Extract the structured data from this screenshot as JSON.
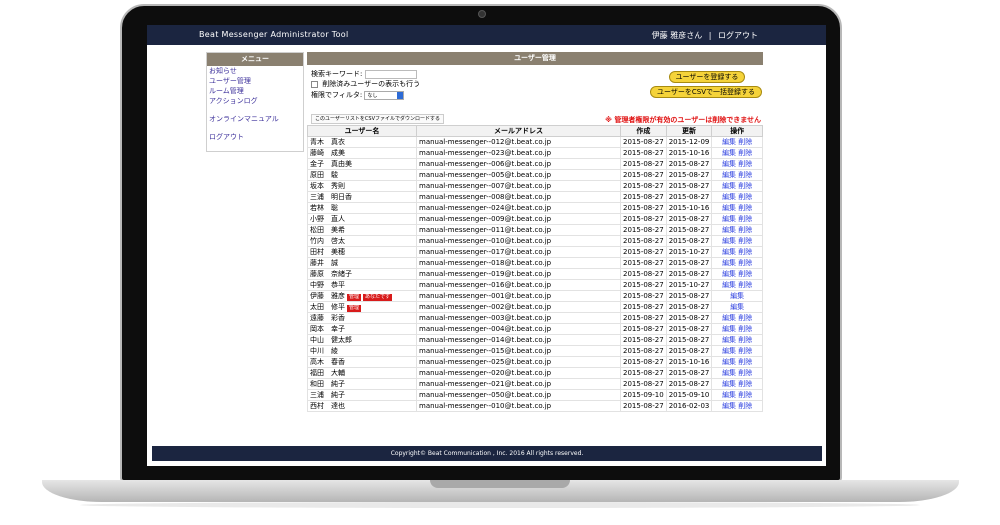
{
  "app": {
    "title": "Beat Messenger Administrator Tool",
    "user_name": "伊藤 雅彦さん",
    "separator": "|",
    "logout": "ログアウト"
  },
  "menu": {
    "header": "メニュー",
    "items_top": [
      "お知らせ",
      "ユーザー管理",
      "ルーム管理",
      "アクションログ"
    ],
    "manual": "オンラインマニュアル",
    "logout": "ログアウト"
  },
  "main": {
    "header": "ユーザー管理",
    "keyword_label": "検索キーワード:",
    "show_deleted_label": "削除済みユーザーの表示も行う",
    "filter_label": "権限でフィルタ:",
    "filter_value": "なし",
    "register_button": "ユーザーを登録する",
    "csv_register_button": "ユーザーをCSVで一括登録する",
    "csv_download": "このユーザーリストをCSVファイルでダウンロードする",
    "warning": "※ 管理者権限が有効のユーザーは削除できません"
  },
  "table": {
    "headers": [
      "ユーザー名",
      "メールアドレス",
      "作成",
      "更新",
      "操作"
    ],
    "edit": "編集",
    "delete": "削除",
    "rows": [
      {
        "name": "青木　真衣",
        "email": "manual-messenger--012@t.beat.co.jp",
        "created": "2015-08-27",
        "updated": "2015-12-09",
        "badges": [],
        "deletable": true
      },
      {
        "name": "藤崎　成美",
        "email": "manual-messenger--023@t.beat.co.jp",
        "created": "2015-08-27",
        "updated": "2015-10-16",
        "badges": [],
        "deletable": true
      },
      {
        "name": "金子　真由美",
        "email": "manual-messenger--006@t.beat.co.jp",
        "created": "2015-08-27",
        "updated": "2015-08-27",
        "badges": [],
        "deletable": true
      },
      {
        "name": "原田　駿",
        "email": "manual-messenger--005@t.beat.co.jp",
        "created": "2015-08-27",
        "updated": "2015-08-27",
        "badges": [],
        "deletable": true
      },
      {
        "name": "坂本　秀則",
        "email": "manual-messenger--007@t.beat.co.jp",
        "created": "2015-08-27",
        "updated": "2015-08-27",
        "badges": [],
        "deletable": true
      },
      {
        "name": "三浦　明日香",
        "email": "manual-messenger--008@t.beat.co.jp",
        "created": "2015-08-27",
        "updated": "2015-08-27",
        "badges": [],
        "deletable": true
      },
      {
        "name": "若林　聡",
        "email": "manual-messenger--024@t.beat.co.jp",
        "created": "2015-08-27",
        "updated": "2015-10-16",
        "badges": [],
        "deletable": true
      },
      {
        "name": "小野　直人",
        "email": "manual-messenger--009@t.beat.co.jp",
        "created": "2015-08-27",
        "updated": "2015-08-27",
        "badges": [],
        "deletable": true
      },
      {
        "name": "松田　美希",
        "email": "manual-messenger--011@t.beat.co.jp",
        "created": "2015-08-27",
        "updated": "2015-08-27",
        "badges": [],
        "deletable": true
      },
      {
        "name": "竹内　啓太",
        "email": "manual-messenger--010@t.beat.co.jp",
        "created": "2015-08-27",
        "updated": "2015-08-27",
        "badges": [],
        "deletable": true
      },
      {
        "name": "田村　美穂",
        "email": "manual-messenger--017@t.beat.co.jp",
        "created": "2015-08-27",
        "updated": "2015-10-27",
        "badges": [],
        "deletable": true
      },
      {
        "name": "藤井　誠",
        "email": "manual-messenger--018@t.beat.co.jp",
        "created": "2015-08-27",
        "updated": "2015-08-27",
        "badges": [],
        "deletable": true
      },
      {
        "name": "藤原　奈緒子",
        "email": "manual-messenger--019@t.beat.co.jp",
        "created": "2015-08-27",
        "updated": "2015-08-27",
        "badges": [],
        "deletable": true
      },
      {
        "name": "中野　恭平",
        "email": "manual-messenger--016@t.beat.co.jp",
        "created": "2015-08-27",
        "updated": "2015-10-27",
        "badges": [],
        "deletable": true
      },
      {
        "name": "伊藤　雅彦",
        "email": "manual-messenger--001@t.beat.co.jp",
        "created": "2015-08-27",
        "updated": "2015-08-27",
        "badges": [
          "管理",
          "あなたです"
        ],
        "deletable": false
      },
      {
        "name": "太田　修平",
        "email": "manual-messenger--002@t.beat.co.jp",
        "created": "2015-08-27",
        "updated": "2015-08-27",
        "badges": [
          "管理"
        ],
        "deletable": false
      },
      {
        "name": "遠藤　彩香",
        "email": "manual-messenger--003@t.beat.co.jp",
        "created": "2015-08-27",
        "updated": "2015-08-27",
        "badges": [],
        "deletable": true
      },
      {
        "name": "岡本　幸子",
        "email": "manual-messenger--004@t.beat.co.jp",
        "created": "2015-08-27",
        "updated": "2015-08-27",
        "badges": [],
        "deletable": true
      },
      {
        "name": "中山　健太郎",
        "email": "manual-messenger--014@t.beat.co.jp",
        "created": "2015-08-27",
        "updated": "2015-08-27",
        "badges": [],
        "deletable": true
      },
      {
        "name": "中川　綾",
        "email": "manual-messenger--015@t.beat.co.jp",
        "created": "2015-08-27",
        "updated": "2015-08-27",
        "badges": [],
        "deletable": true
      },
      {
        "name": "高木　春香",
        "email": "manual-messenger--025@t.beat.co.jp",
        "created": "2015-08-27",
        "updated": "2015-10-16",
        "badges": [],
        "deletable": true
      },
      {
        "name": "福田　大輔",
        "email": "manual-messenger--020@t.beat.co.jp",
        "created": "2015-08-27",
        "updated": "2015-08-27",
        "badges": [],
        "deletable": true
      },
      {
        "name": "和田　純子",
        "email": "manual-messenger--021@t.beat.co.jp",
        "created": "2015-08-27",
        "updated": "2015-08-27",
        "badges": [],
        "deletable": true
      },
      {
        "name": "三浦　純子",
        "email": "manual-messenger--050@t.beat.co.jp",
        "created": "2015-09-10",
        "updated": "2015-09-10",
        "badges": [],
        "deletable": true
      },
      {
        "name": "西村　達也",
        "email": "manual-messenger--010@t.beat.co.jp",
        "created": "2015-08-27",
        "updated": "2016-02-03",
        "badges": [],
        "deletable": true
      }
    ]
  },
  "footer": {
    "copyright": "Copyright© Beat Communication , Inc. 2016 All rights reserved."
  },
  "colors": {
    "navbar": "#1b2540",
    "panel_header": "#8a8070",
    "button_yellow": "#f5d33a",
    "link_blue": "#2b3ee0",
    "warning_red": "#e01010",
    "badge_red": "#d81b1b"
  }
}
